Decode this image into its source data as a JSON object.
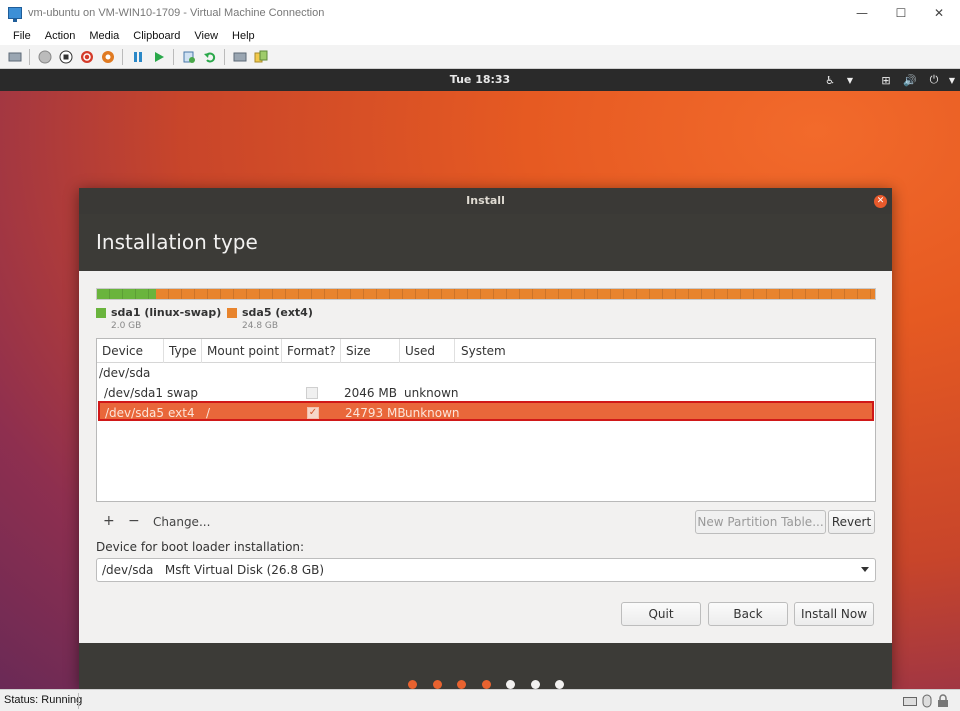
{
  "window": {
    "title": "vm-ubuntu on VM-WIN10-1709 - Virtual Machine Connection",
    "minimize": "—",
    "maximize": "☐",
    "close": "✕"
  },
  "menu": [
    "File",
    "Action",
    "Media",
    "Clipboard",
    "View",
    "Help"
  ],
  "toolbar": {
    "icons": [
      "ctrl-alt-del-icon",
      "start-icon",
      "turn-off-icon",
      "shut-down-icon",
      "save-icon",
      "pause-icon",
      "resume-icon",
      "checkpoint-icon",
      "revert-icon",
      "enhanced-session-icon",
      "share-icon"
    ]
  },
  "ubuntu_topbar": {
    "clock": "Tue 18:33",
    "accessibility_icon": "♿",
    "network_icon": "⊞",
    "volume_icon": "🔊",
    "power_icon": "⏻"
  },
  "installer": {
    "window_title": "Install",
    "heading": "Installation type",
    "partition_bar": {
      "segments": [
        {
          "name": "sda1",
          "fraction": 0.076,
          "color": "#6ab43d"
        },
        {
          "name": "sda5",
          "fraction": 0.924,
          "color": "#e8842d"
        }
      ]
    },
    "legend": [
      {
        "label": "sda1 (linux-swap)",
        "size": "2.0 GB",
        "color": "#6ab43d"
      },
      {
        "label": "sda5 (ext4)",
        "size": "24.8 GB",
        "color": "#e8842d"
      }
    ],
    "table": {
      "columns": [
        "Device",
        "Type",
        "Mount point",
        "Format?",
        "Size",
        "Used",
        "System"
      ],
      "group": "/dev/sda",
      "rows": [
        {
          "device": "/dev/sda1",
          "type": "swap",
          "mount": "",
          "format": false,
          "size": "2046 MB",
          "used": "unknown",
          "system": ""
        },
        {
          "device": "/dev/sda5",
          "type": "ext4",
          "mount": "/",
          "format": true,
          "size": "24793 MB",
          "used": "unknown",
          "system": "",
          "selected": true
        }
      ]
    },
    "actions": {
      "add": "+",
      "remove": "−",
      "change": "Change...",
      "new_partition_table": "New Partition Table...",
      "revert": "Revert"
    },
    "boot_loader_label": "Device for boot loader installation:",
    "boot_loader_value": "/dev/sda   Msft Virtual Disk (26.8 GB)",
    "buttons": {
      "quit": "Quit",
      "back": "Back",
      "install_now": "Install Now"
    },
    "checkmark": "✓"
  },
  "progress_dots": {
    "total": 7,
    "done": 4,
    "done_color": "#e8622f",
    "todo_color": "#f2f1f0"
  },
  "statusbar": {
    "status": "Status: Running"
  }
}
